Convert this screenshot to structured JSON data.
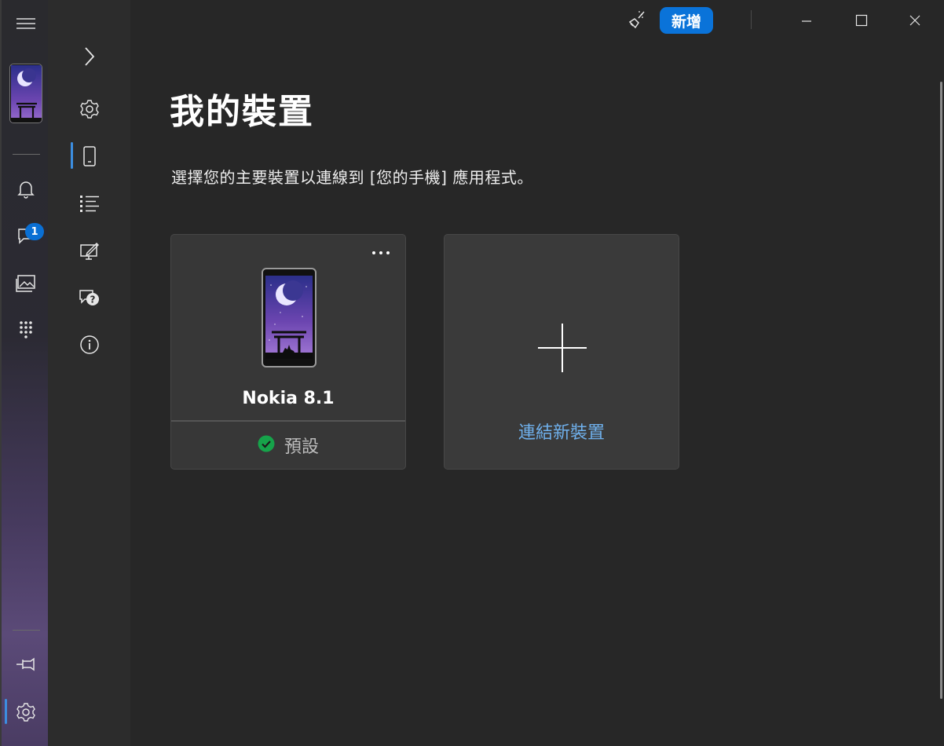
{
  "window": {
    "titlebar": {
      "new_label": "新增",
      "minimize_icon": "minimize-icon",
      "maximize_icon": "maximize-icon",
      "close_icon": "close-icon"
    }
  },
  "rail": {
    "items": [
      {
        "name": "hamburger-menu-icon"
      },
      {
        "name": "phone-thumbnail"
      },
      {
        "name": "bell-icon"
      },
      {
        "name": "messages-icon",
        "badge": "1"
      },
      {
        "name": "photos-icon"
      },
      {
        "name": "dialpad-icon"
      },
      {
        "name": "pin-icon"
      },
      {
        "name": "settings-icon"
      }
    ]
  },
  "settings_nav": {
    "items": [
      {
        "name": "expand-chevron-icon"
      },
      {
        "name": "general-settings-icon"
      },
      {
        "name": "my-devices-icon",
        "active": true
      },
      {
        "name": "features-list-icon"
      },
      {
        "name": "personalization-icon"
      },
      {
        "name": "feedback-icon"
      },
      {
        "name": "about-icon"
      }
    ]
  },
  "main": {
    "title": "我的裝置",
    "description": "選擇您的主要裝置以連線到 [您的手機] 應用程式。",
    "device_card": {
      "name": "Nokia 8.1",
      "status": "預設",
      "more_icon": "more-options-icon"
    },
    "add_card": {
      "label": "連結新裝置"
    }
  },
  "colors": {
    "accent": "#0a73d9",
    "link": "#6fb0ec",
    "success": "#16a34a",
    "background": "#272727"
  }
}
